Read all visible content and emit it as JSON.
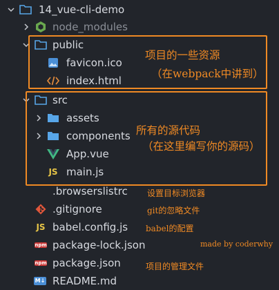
{
  "tree": {
    "root_label": "14_vue-cli-demo",
    "node_modules": "node_modules",
    "public": "public",
    "favicon": "favicon.ico",
    "index_html": "index.html",
    "src": "src",
    "assets": "assets",
    "components": "components",
    "app_vue": "App.vue",
    "main_js": "main.js",
    "browserslistrc": ".browserslistrc",
    "gitignore": ".gitignore",
    "babel_config": "babel.config.js",
    "package_lock": "package-lock.json",
    "package_json": "package.json",
    "readme": "README.md"
  },
  "icons": {
    "npm_text": "npm",
    "md_text": "M↓",
    "js_text": "JS"
  },
  "notes": {
    "public_line1": "项目的一些资源",
    "public_line2": "（在webpack中讲到）",
    "src_line1": "所有的源代码",
    "src_line2": "（在这里编写你的源码）",
    "browserslist": "设置目标浏览器",
    "gitignore": "git的忽略文件",
    "babel": "babel的配置",
    "credit": "made by coderwhy",
    "package": "项目的管理文件"
  },
  "colors": {
    "annotation": "#f08a24",
    "folder": "#58a6e8",
    "vue": "#41b883",
    "js": "#e7c547",
    "git": "#e0573b",
    "npm": "#cb3837"
  }
}
